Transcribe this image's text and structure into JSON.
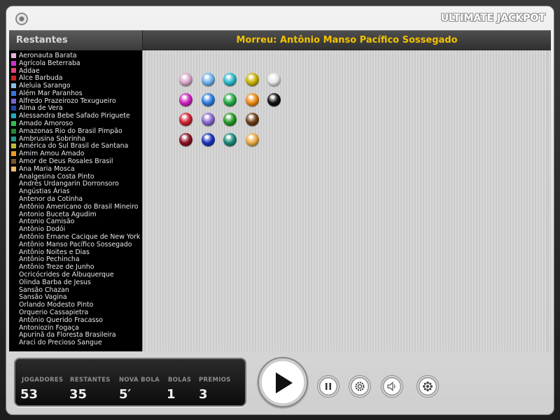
{
  "app": {
    "title": "ULTIMATE JACKPOT"
  },
  "header": {
    "remaining_heading": "Restantes",
    "dead_announcement": "Morreu: Antônio Manso Pacífico Sossegado"
  },
  "players": [
    {
      "name": "Aeronauta Barata",
      "color": "#e8b4d8"
    },
    {
      "name": "Agrícola Beterraba",
      "color": "#cc33cc"
    },
    {
      "name": "Addae",
      "color": "#e0447a"
    },
    {
      "name": "Alce Barbuda",
      "color": "#cc2222"
    },
    {
      "name": "Aleluia Sarango",
      "color": "#88bbee"
    },
    {
      "name": "Além Mar Paranhos",
      "color": "#3377dd"
    },
    {
      "name": "Alfredo Prazeirozo Texugueiro",
      "color": "#7766cc"
    },
    {
      "name": "Alma de Vera",
      "color": "#2244aa"
    },
    {
      "name": "Alessandra Bebe Safado Piriguete",
      "color": "#22aabb"
    },
    {
      "name": "Amado Amoroso",
      "color": "#33bb55"
    },
    {
      "name": "Amazonas Rio do Brasil Pimpão",
      "color": "#228833"
    },
    {
      "name": "Ambrusina Sobrinha",
      "color": "#229988"
    },
    {
      "name": "América do Sul Brasil de Santana",
      "color": "#bbbb33"
    },
    {
      "name": "Amim Amou Amado",
      "color": "#ee9922"
    },
    {
      "name": "Amor de Deus Rosales Brasil",
      "color": "#775533"
    },
    {
      "name": "Ana Maria Mosca",
      "color": "#eebb66"
    },
    {
      "name": "Analgesina Costa Pinto",
      "color": ""
    },
    {
      "name": "Andrés Urdangarin Dorronsoro",
      "color": ""
    },
    {
      "name": "Angústias Árias",
      "color": ""
    },
    {
      "name": "Antenor da Cotinha",
      "color": ""
    },
    {
      "name": "Antônio Americano do Brasil Mineiro",
      "color": ""
    },
    {
      "name": "Antonio Buceta Agudim",
      "color": ""
    },
    {
      "name": "Antonio Camisão",
      "color": ""
    },
    {
      "name": "Antônio Dodói",
      "color": ""
    },
    {
      "name": "Antônio Ernane Cacique de New York",
      "color": ""
    },
    {
      "name": "Antônio Manso Pacífico Sossegado",
      "color": ""
    },
    {
      "name": "Antônio Noites e Dias",
      "color": ""
    },
    {
      "name": "Antônio Pechincha",
      "color": ""
    },
    {
      "name": "Antônio Treze de Junho",
      "color": ""
    },
    {
      "name": "Ocricócrides de Albuquerque",
      "color": ""
    },
    {
      "name": "Olinda Barba de Jesus",
      "color": ""
    },
    {
      "name": "Sansão Chazan",
      "color": ""
    },
    {
      "name": "Sansão Vagina",
      "color": ""
    },
    {
      "name": "Orlando Modesto Pinto",
      "color": ""
    },
    {
      "name": "Orquerio Cassapietra",
      "color": ""
    },
    {
      "name": "Antônio Querido Fracasso",
      "color": ""
    },
    {
      "name": "Antoniozin Fogaça",
      "color": ""
    },
    {
      "name": "Apurinã da Floresta Brasileira",
      "color": ""
    },
    {
      "name": "Araci do Precioso Sangue",
      "color": ""
    }
  ],
  "balls": [
    [
      "#d9a6c8",
      "#6fb0f0",
      "#27b8c8",
      "#c8b000",
      "#e6e6e6"
    ],
    [
      "#cc22bb",
      "#2e7de0",
      "#22aa44",
      "#ee8811",
      "#111111"
    ],
    [
      "#cc2233",
      "#8866cc",
      "#229922",
      "#6b3d14"
    ],
    [
      "#881122",
      "#1a33bb",
      "#1a8877",
      "#e8aa44"
    ]
  ],
  "stats": [
    {
      "label": "JOGADORES",
      "value": "53"
    },
    {
      "label": "RESTANTES",
      "value": "35"
    },
    {
      "label": "NOVA BOLA",
      "value": "5′"
    },
    {
      "label": "BOLAS",
      "value": "1"
    },
    {
      "label": "PREMIOS",
      "value": "3"
    }
  ],
  "controls": {
    "play": "play-icon",
    "pause": "pause-icon",
    "settings": "gear-icon",
    "sound": "speaker-icon",
    "prizes": "flower-icon"
  }
}
